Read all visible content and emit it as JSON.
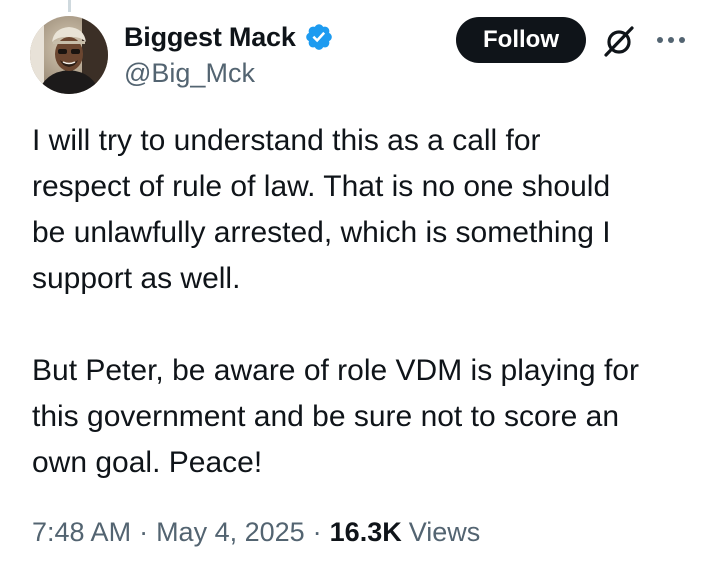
{
  "author": {
    "display_name": "Biggest Mack",
    "handle": "@Big_Mck",
    "verified": true,
    "avatar_icon": "person-avatar"
  },
  "actions": {
    "follow_label": "Follow",
    "grok_icon": "slashed-circle-icon",
    "more_icon": "more-dots-icon"
  },
  "tweet": {
    "paragraphs": [
      "I will try to understand this as a call for\nrespect of rule of law. That is no one should\nbe unlawfully arrested, which is something I\nsupport as well.",
      "But Peter, be aware of role VDM is playing for\nthis government and be sure not to score an\nown goal. Peace!"
    ]
  },
  "meta": {
    "time": "7:48 AM",
    "separator": "·",
    "date": "May 4, 2025",
    "views_count": "16.3K",
    "views_label": "Views"
  },
  "colors": {
    "text_primary": "#0f1419",
    "text_secondary": "#536471",
    "verified_blue": "#1d9bf0",
    "follow_bg": "#0f1419"
  }
}
